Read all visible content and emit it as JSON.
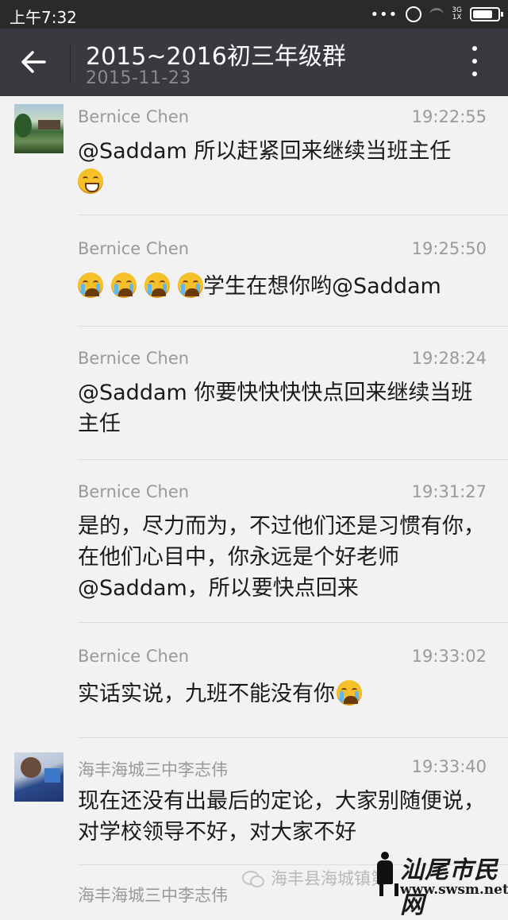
{
  "status_bar": {
    "time": "上午7:32",
    "network": "3G",
    "network_sub": "1X",
    "icons": [
      "dots-icon",
      "alarm-icon",
      "wifi-icon",
      "signal-icon",
      "battery-icon"
    ]
  },
  "header": {
    "title": "2015~2016初三年级群",
    "date": "2015-11-23",
    "background": "#393a3f",
    "icons": [
      "back-arrow-icon",
      "more-vertical-icon"
    ]
  },
  "messages": [
    {
      "sender": "Bernice Chen",
      "time": "19:22:55",
      "text_before": "@Saddam 所以赶紧回来继续当班主任",
      "emoji": [
        "grin"
      ],
      "text_after": ""
    },
    {
      "sender": "Bernice Chen",
      "time": "19:25:50",
      "text_before": "",
      "emoji": [
        "cry",
        "cry",
        "cry",
        "cry"
      ],
      "text_after": "学生在想你哟@Saddam"
    },
    {
      "sender": "Bernice Chen",
      "time": "19:28:24",
      "text_before": "@Saddam 你要快快快快点回来继续当班主任",
      "emoji": [],
      "text_after": ""
    },
    {
      "sender": "Bernice Chen",
      "time": "19:31:27",
      "text_before": "是的，尽力而为，不过他们还是习惯有你，在他们心目中，你永远是个好老师@Saddam，所以要快点回来",
      "emoji": [],
      "text_after": ""
    },
    {
      "sender": "Bernice Chen",
      "time": "19:33:02",
      "text_before": "实话实说，九班不能没有你",
      "emoji": [
        "cry"
      ],
      "text_after": ""
    },
    {
      "sender": "海丰海城三中李志伟",
      "time": "19:33:40",
      "text_before": "现在还没有出最后的定论，大家别随便说，对学校领导不好，对大家不好",
      "emoji": [],
      "text_after": ""
    },
    {
      "sender": "海丰海城三中李志伟",
      "time": "",
      "text_before": "",
      "emoji": [],
      "text_after": ""
    }
  ],
  "watermark": {
    "text": "海丰县海城镇第",
    "site_brand": "汕尾市民网",
    "site_url": "www.swsm.net"
  },
  "colors": {
    "status_bar": "#2a2a2a",
    "chat_background": "#f2f2f2",
    "sender_text": "#999999",
    "message_text": "#1a1a1a"
  }
}
